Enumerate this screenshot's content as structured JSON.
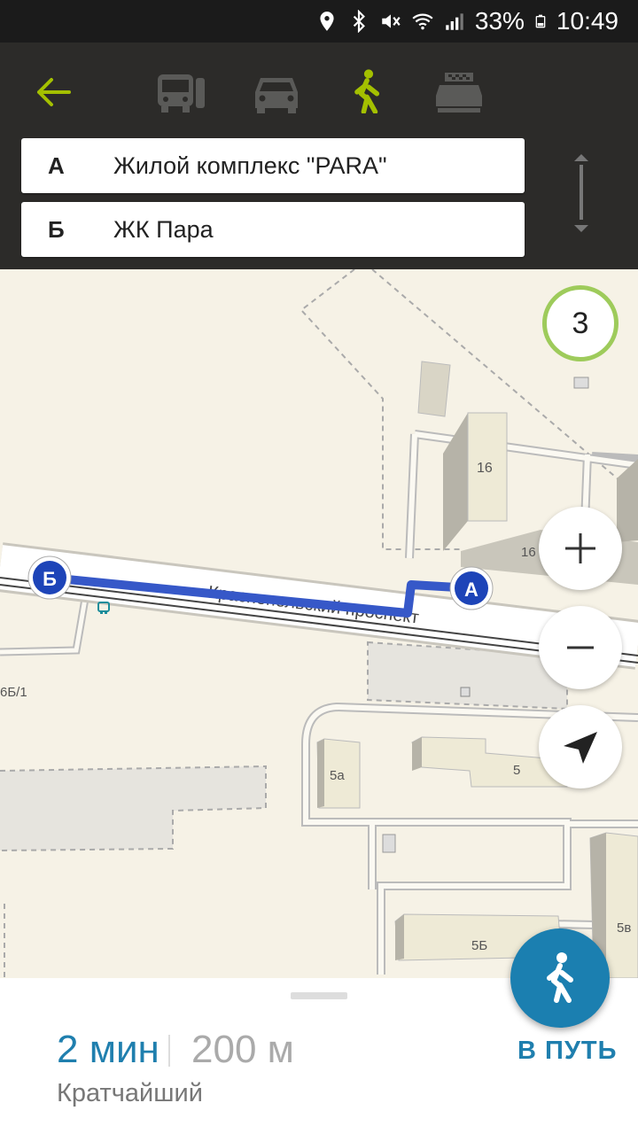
{
  "status_bar": {
    "battery": "33%",
    "time": "10:49",
    "icons": [
      "location-icon",
      "bluetooth-icon",
      "mute-icon",
      "wifi-icon",
      "signal-icon",
      "battery-icon"
    ]
  },
  "header": {
    "modes": [
      "bus-icon",
      "car-icon",
      "walk-icon",
      "taxi-icon"
    ],
    "active_mode": "walk",
    "accent_color": "#a4c000",
    "from": {
      "letter": "А",
      "text": "Жилой комплекс \"PARA\""
    },
    "to": {
      "letter": "Б",
      "text": "ЖК Пара"
    }
  },
  "map": {
    "street_label": "Краснопольский проспект",
    "building_labels": {
      "b16": "16",
      "b16_2": "16",
      "b5a": "5а",
      "b5": "5",
      "b5b": "5Б",
      "b5v": "5в",
      "b6b1": "6Б/1"
    },
    "marker_a": "А",
    "marker_b": "Б",
    "cluster_count": "3",
    "route_color": "#3658c8"
  },
  "bottom": {
    "time": "2 мин",
    "distance": "200 м",
    "route_type": "Кратчайший",
    "go_label": "В ПУТЬ"
  }
}
